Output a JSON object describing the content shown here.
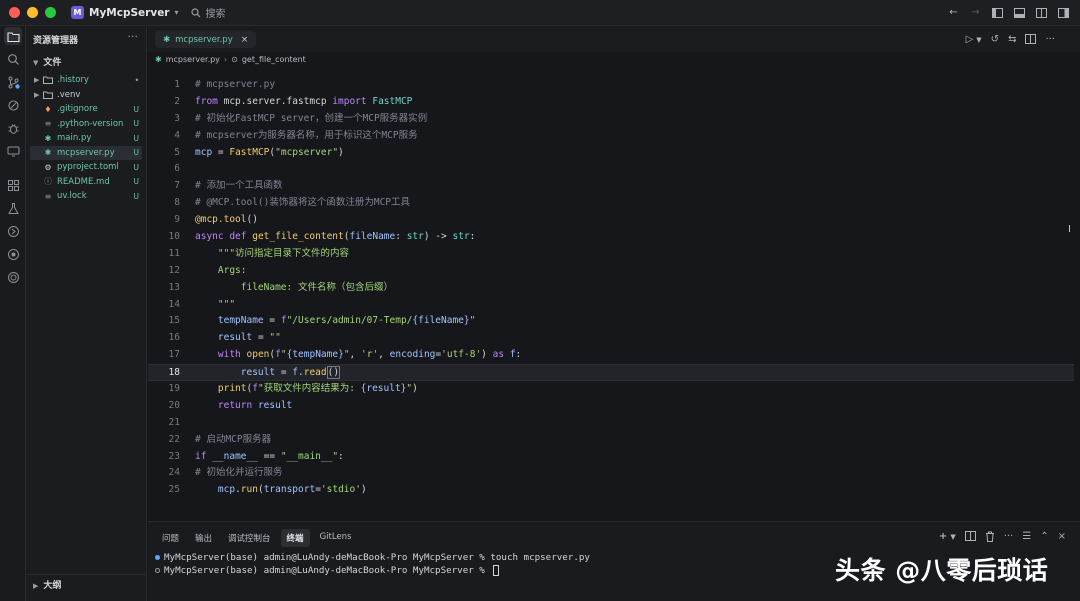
{
  "titlebar": {
    "app_badge": "M",
    "app_name": "MyMcpServer",
    "search_label": "搜索"
  },
  "sidebar": {
    "title": "资源管理器",
    "section": "文件",
    "outline": "大纲",
    "files": [
      {
        "name": ".history",
        "status": "•",
        "type": "folder"
      },
      {
        "name": ".venv",
        "status": "",
        "type": "folder"
      },
      {
        "name": ".gitignore",
        "status": "U",
        "type": "git"
      },
      {
        "name": ".python-version",
        "status": "U",
        "type": "text"
      },
      {
        "name": "main.py",
        "status": "U",
        "type": "python"
      },
      {
        "name": "mcpserver.py",
        "status": "U",
        "type": "python"
      },
      {
        "name": "pyproject.toml",
        "status": "U",
        "type": "gear"
      },
      {
        "name": "README.md",
        "status": "U",
        "type": "info"
      },
      {
        "name": "uv.lock",
        "status": "U",
        "type": "text"
      }
    ]
  },
  "editor": {
    "tab_label": "mcpserver.py",
    "breadcrumb_file": "mcpserver.py",
    "breadcrumb_symbol": "get_file_content",
    "current_line": 18
  },
  "panel": {
    "tabs": [
      "问题",
      "输出",
      "调试控制台",
      "终端",
      "GitLens"
    ],
    "active_tab": "终端",
    "terminal": [
      "MyMcpServer(base) admin@LuAndy-deMacBook-Pro MyMcpServer % touch mcpserver.py",
      "MyMcpServer(base) admin@LuAndy-deMacBook-Pro MyMcpServer % "
    ]
  },
  "watermark": "头条 @八零后琐话",
  "colors": {
    "accent": "#6ec7a4",
    "keyword": "#c084fc",
    "string": "#a3d57a",
    "function": "#f2cc6b",
    "comment": "#7e8593"
  }
}
